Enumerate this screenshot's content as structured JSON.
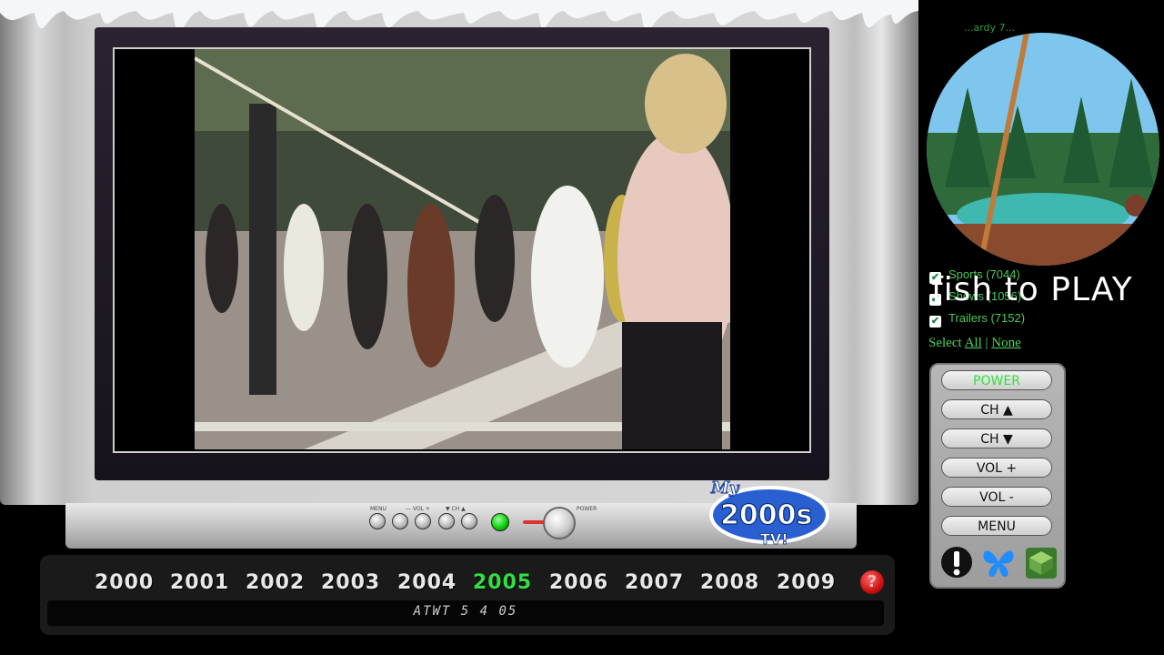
{
  "tv": {
    "years": [
      "2000",
      "2001",
      "2002",
      "2003",
      "2004",
      "2005",
      "2006",
      "2007",
      "2008",
      "2009"
    ],
    "active_year": "2005",
    "ticker": "ATWT 5 4 05",
    "help": "?",
    "control_labels": {
      "menu": "MENU",
      "vol": "— VOL +",
      "ch": "▼ CH ▲",
      "power": "POWER"
    }
  },
  "brand": {
    "line1": "My",
    "line2": "2000s",
    "line3": "TV!"
  },
  "game_overlay": "fish to PLAY",
  "minigame_title": "...ardy 7...",
  "categories": [
    {
      "label": "Sports (7044)",
      "checked": true
    },
    {
      "label": "Shows (1056)",
      "checked": true
    },
    {
      "label": "Trailers (7152)",
      "checked": true
    }
  ],
  "select": {
    "prefix": "Select",
    "all": "All",
    "sep": "|",
    "none": "None"
  },
  "remote": {
    "power": "POWER",
    "ch_up": "CH ▲",
    "ch_down": "CH ▼",
    "vol_up": "VOL +",
    "vol_down": "VOL -",
    "menu": "MENU"
  },
  "colors": {
    "accent_green": "#33dd44",
    "help_red": "#cc1111",
    "butterfly_blue": "#1f8cff"
  }
}
